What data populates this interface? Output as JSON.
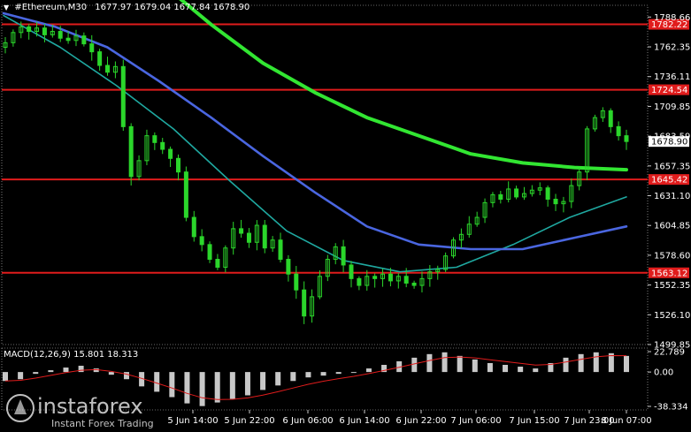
{
  "header": {
    "symbol": "#Ethereum,M30",
    "quote": "1677.97 1679.04 1677.84 1678.90"
  },
  "price_axis": {
    "ticks": [
      "1788.66",
      "1762.35",
      "1736.11",
      "1709.85",
      "1683.59",
      "1657.35",
      "1631.10",
      "1604.85",
      "1578.60",
      "1552.35",
      "1526.10",
      "1499.85"
    ],
    "current_price": "1678.90"
  },
  "levels": [
    {
      "label": "1782.22",
      "value": 1782.22
    },
    {
      "label": "1724.54",
      "value": 1724.54
    },
    {
      "label": "1645.42",
      "value": 1645.42
    },
    {
      "label": "1563.12",
      "value": 1563.12
    }
  ],
  "time_axis": {
    "labels": [
      "5 Jun 14:00",
      "5 Jun 22:00",
      "6 Jun 06:00",
      "6 Jun 14:00",
      "6 Jun 22:00",
      "7 Jun 06:00",
      "7 Jun 15:00",
      "7 Jun 23:00",
      "8 Jun 07:00"
    ]
  },
  "macd": {
    "label": "MACD(12,26,9) 15.801 18.313",
    "ticks": [
      "22.789",
      "0.00",
      "-38.334"
    ]
  },
  "watermark": {
    "name": "instaforex",
    "tagline": "Instant Forex Trading"
  },
  "colors": {
    "background": "#000000",
    "candles": "#2bd62b",
    "ma_fast": "#1fa8a0",
    "ma_mid": "#4a66e0",
    "ma_slow": "#32e632",
    "levels": "#e01c1c",
    "macd_hist": "#c8c8c8",
    "macd_signal": "#e01c1c"
  },
  "chart_data": {
    "type": "candlestick",
    "symbol": "#Ethereum",
    "timeframe": "M30",
    "ylim": [
      1499.85,
      1799
    ],
    "current_price": 1678.9,
    "candles": [
      1766,
      1775,
      1780,
      1776,
      1779,
      1773,
      1776,
      1770,
      1768,
      1772,
      1765,
      1758,
      1746,
      1740,
      1745,
      1692,
      1648,
      1662,
      1684,
      1678,
      1672,
      1664,
      1652,
      1612,
      1595,
      1588,
      1575,
      1568,
      1585,
      1602,
      1598,
      1590,
      1605,
      1585,
      1592,
      1575,
      1562,
      1548,
      1525,
      1542,
      1560,
      1575,
      1586,
      1570,
      1558,
      1552,
      1560,
      1558,
      1562,
      1556,
      1560,
      1554,
      1552,
      1558,
      1564,
      1566,
      1578,
      1592,
      1597,
      1606,
      1612,
      1625,
      1632,
      1628,
      1637,
      1630,
      1633,
      1636,
      1638,
      1628,
      1624,
      1626,
      1640,
      1652,
      1690,
      1700,
      1706,
      1692,
      1684,
      1678.9
    ],
    "moving_averages": {
      "slow_green": [
        1820,
        1782,
        1748,
        1722,
        1700,
        1684,
        1668,
        1660,
        1656,
        1654
      ],
      "mid_blue": [
        1792,
        1780,
        1762,
        1732,
        1700,
        1666,
        1634,
        1604,
        1588,
        1584,
        1584,
        1594,
        1604
      ],
      "fast_teal": [
        1790,
        1762,
        1728,
        1690,
        1644,
        1600,
        1574,
        1564,
        1568,
        1588,
        1612,
        1630
      ]
    },
    "macd": {
      "params": "12,26,9",
      "main": 15.801,
      "signal": 18.313,
      "ylim": [
        -38.334,
        22.789
      ],
      "histogram": [
        -10,
        -8,
        -2,
        2,
        5,
        7,
        4,
        -3,
        -8,
        -16,
        -22,
        -28,
        -35,
        -38,
        -34,
        -30,
        -26,
        -20,
        -15,
        -10,
        -6,
        -4,
        -2,
        0,
        4,
        8,
        12,
        16,
        20,
        22,
        18,
        14,
        10,
        8,
        6,
        4,
        10,
        16,
        20,
        22,
        21,
        18
      ]
    }
  }
}
